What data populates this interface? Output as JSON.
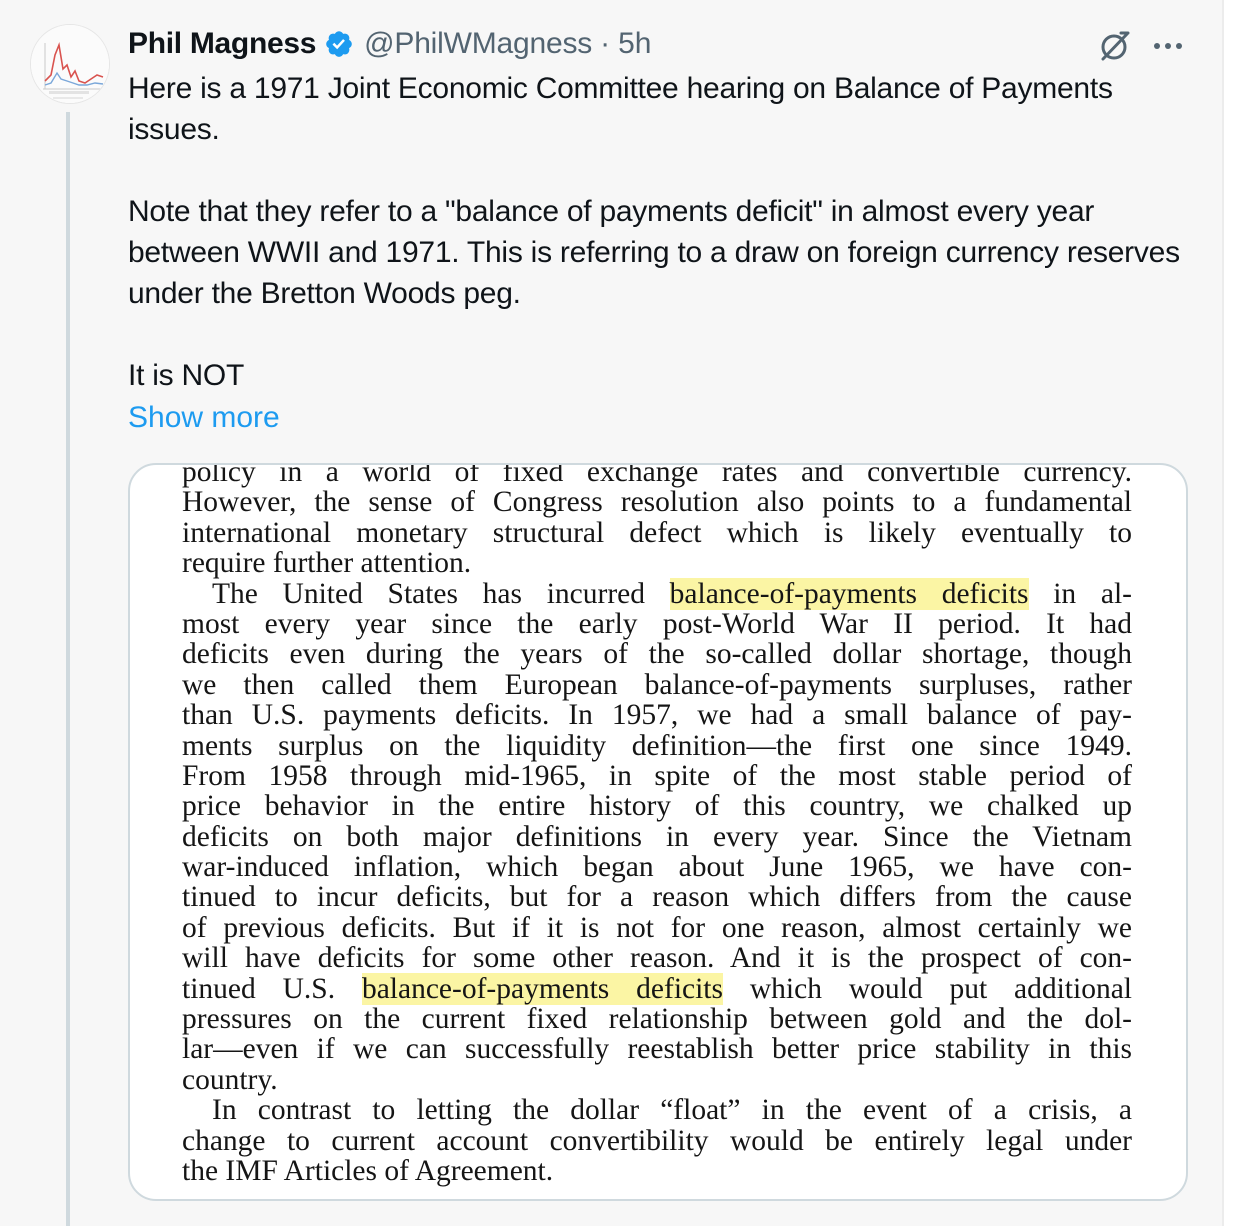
{
  "author": {
    "name": "Phil Magness",
    "handle": "@PhilWMagness",
    "separator": "·",
    "time": "5h"
  },
  "icons": {
    "verified": "verified-badge-icon",
    "grok": "grok-icon",
    "more": "more-options-icon",
    "avatar": "avatar-image"
  },
  "colors": {
    "link": "#1d9bf0",
    "verified": "#1d9bf0",
    "secondary_text": "#536471",
    "highlight": "#fbf5a4"
  },
  "tweet": {
    "paragraphs": [
      "Here is a 1971 Joint Economic Committee hearing on Balance of Payments issues.",
      "Note that they refer to a \"balance of payments deficit\" in almost every year between WWII and 1971. This is referring to a draw on foreign currency reserves under the Bretton Woods peg.",
      "It is NOT"
    ],
    "show_more": "Show more"
  },
  "document": {
    "lines": [
      [
        "policy in a world of fixed exchange rates and convertible currency."
      ],
      [
        "However, the sense of Congress resolution also points to a fundamental"
      ],
      [
        "international monetary structural defect which is likely eventually to"
      ],
      [
        "require further attention."
      ],
      [
        "The United States has incurred ",
        "balance-of-payments deficits",
        " in al-"
      ],
      [
        "most every year since the early post-World War II period. It had"
      ],
      [
        "deficits even during the years of the so-called dollar shortage, though"
      ],
      [
        "we then called them European balance-of-payments surpluses, rather"
      ],
      [
        "than U.S. payments deficits. In 1957, we had a small balance of pay-"
      ],
      [
        "ments surplus on the liquidity definition—the first one since 1949."
      ],
      [
        "From 1958 through mid-1965, in spite of the most stable period of"
      ],
      [
        "price behavior in the entire history of this country, we chalked up"
      ],
      [
        "deficits on both major definitions in every year. Since the Vietnam"
      ],
      [
        "war-induced inflation, which began about June 1965, we have con-"
      ],
      [
        "tinued to incur deficits, but for a reason which differs from the cause"
      ],
      [
        "of previous deficits. But if it is not for one reason, almost certainly we"
      ],
      [
        "will have deficits for some other reason. And it is the prospect of con-"
      ],
      [
        "tinued U.S. ",
        "balance-of-payments deficits",
        " which would put additional"
      ],
      [
        "pressures on the current fixed relationship between gold and the dol-"
      ],
      [
        "lar—even if we can successfully reestablish better price stability in this"
      ],
      [
        "country."
      ],
      [
        "In contrast to letting the dollar “float” in the event of a crisis, a"
      ],
      [
        "change to current account convertibility would be entirely legal under"
      ],
      [
        "the IMF Articles of Agreement."
      ]
    ]
  }
}
